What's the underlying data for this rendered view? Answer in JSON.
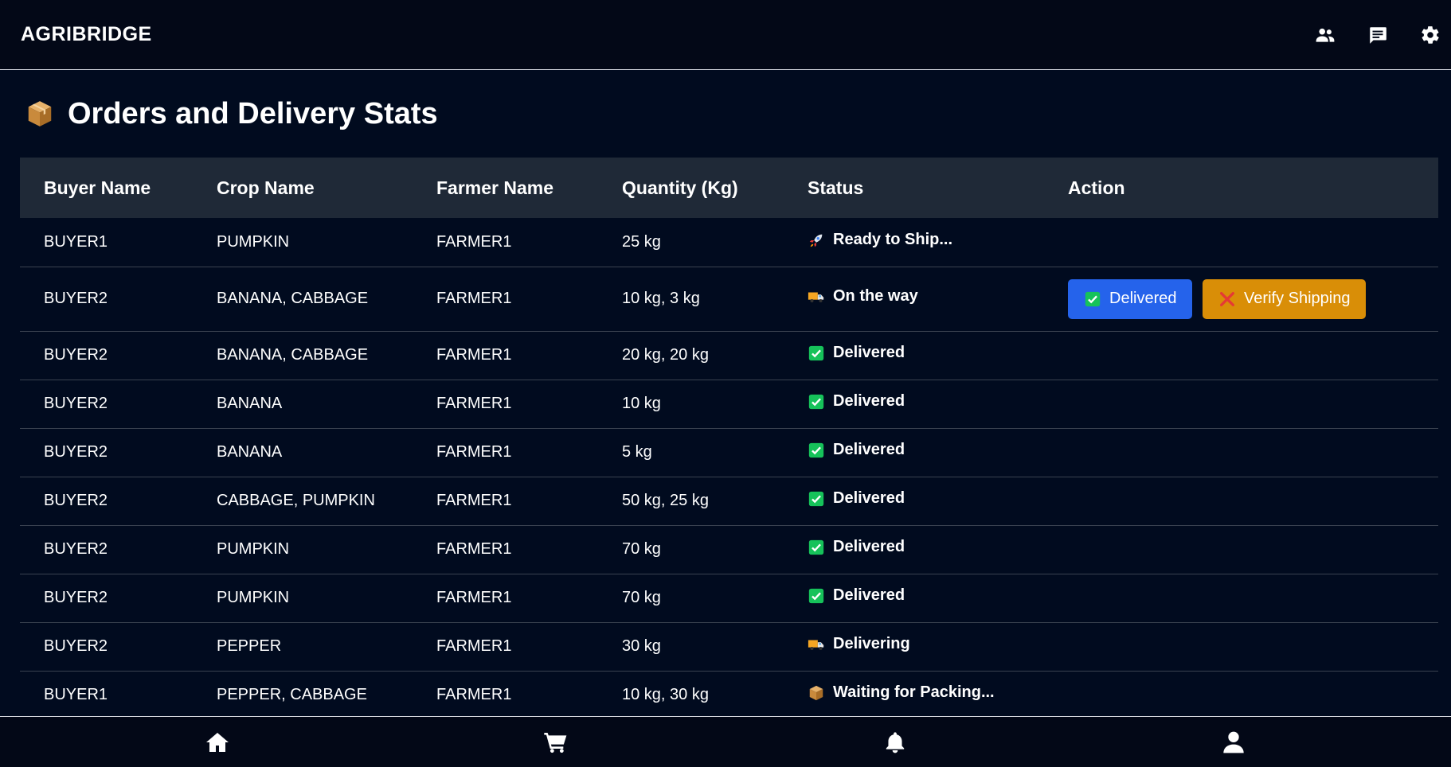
{
  "app": {
    "brand": "AGRIBRIDGE"
  },
  "header_icons": [
    "users-icon",
    "chat-icon",
    "gear-icon"
  ],
  "page": {
    "title": "Orders and Delivery Stats",
    "title_icon": "package-icon"
  },
  "table": {
    "columns": [
      "Buyer Name",
      "Crop Name",
      "Farmer Name",
      "Quantity (Kg)",
      "Status",
      "Action"
    ],
    "rows": [
      {
        "buyer": "BUYER1",
        "crop": "PUMPKIN",
        "farmer": "FARMER1",
        "qty": "25 kg",
        "status": "Ready to Ship...",
        "status_icon": "rocket-icon"
      },
      {
        "buyer": "BUYER2",
        "crop": "BANANA, CABBAGE",
        "farmer": "FARMER1",
        "qty": "10 kg, 3 kg",
        "status": "On the way",
        "status_icon": "truck-icon",
        "actions": {
          "delivered": "Delivered",
          "verify": "Verify Shipping"
        }
      },
      {
        "buyer": "BUYER2",
        "crop": "BANANA, CABBAGE",
        "farmer": "FARMER1",
        "qty": "20 kg, 20 kg",
        "status": "Delivered",
        "status_icon": "check-icon"
      },
      {
        "buyer": "BUYER2",
        "crop": "BANANA",
        "farmer": "FARMER1",
        "qty": "10 kg",
        "status": "Delivered",
        "status_icon": "check-icon"
      },
      {
        "buyer": "BUYER2",
        "crop": "BANANA",
        "farmer": "FARMER1",
        "qty": "5 kg",
        "status": "Delivered",
        "status_icon": "check-icon"
      },
      {
        "buyer": "BUYER2",
        "crop": "CABBAGE, PUMPKIN",
        "farmer": "FARMER1",
        "qty": "50 kg, 25 kg",
        "status": "Delivered",
        "status_icon": "check-icon"
      },
      {
        "buyer": "BUYER2",
        "crop": "PUMPKIN",
        "farmer": "FARMER1",
        "qty": "70 kg",
        "status": "Delivered",
        "status_icon": "check-icon"
      },
      {
        "buyer": "BUYER2",
        "crop": "PUMPKIN",
        "farmer": "FARMER1",
        "qty": "70 kg",
        "status": "Delivered",
        "status_icon": "check-icon"
      },
      {
        "buyer": "BUYER2",
        "crop": "PEPPER",
        "farmer": "FARMER1",
        "qty": "30 kg",
        "status": "Delivering",
        "status_icon": "truck-icon"
      },
      {
        "buyer": "BUYER1",
        "crop": "PEPPER, CABBAGE",
        "farmer": "FARMER1",
        "qty": "10 kg, 30 kg",
        "status": "Waiting for Packing...",
        "status_icon": "package-icon"
      }
    ]
  },
  "bottom_nav": [
    "home-icon",
    "cart-icon",
    "bell-icon",
    "user-icon"
  ],
  "colors": {
    "background": "#010b1f",
    "header_row": "#1f2937",
    "delivered_button": "#2563eb",
    "verify_button": "#d98e07",
    "check_green": "#16c25a"
  }
}
